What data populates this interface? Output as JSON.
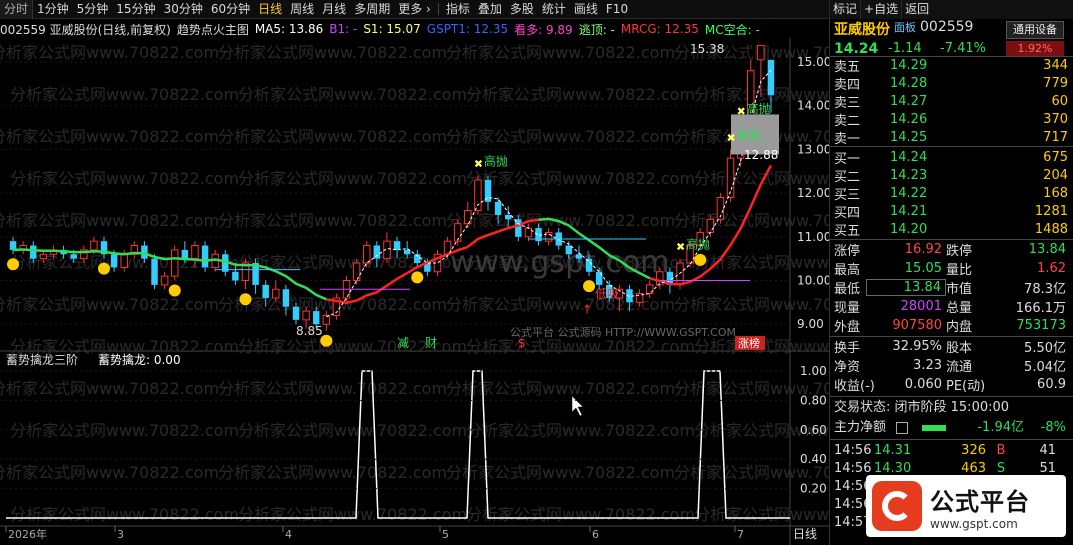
{
  "toolbar": {
    "first": "分时",
    "items": [
      "1分钟",
      "5分钟",
      "15分钟",
      "30分钟",
      "60分钟",
      "日线",
      "周线",
      "月线",
      "多周期",
      "更多"
    ],
    "more_arrow": "更多 ›",
    "buttons": [
      "指标",
      "叠加",
      "多股",
      "统计",
      "画线",
      "F10",
      "标记",
      "+自选",
      "返回"
    ]
  },
  "info": {
    "code_name": "002559 亚威股份(日线,前复权)",
    "indicator": "趋势点火主图",
    "ma5": "MA5: 13.86",
    "b1": "B1: -",
    "s1": "S1: 15.07",
    "gspt": "GSPT1: 12.35",
    "kanduo": "看多: 9.89",
    "taoding": "逃顶: -",
    "mrcg": "MRCG: 12.35",
    "mckonghe": "MC空合: -"
  },
  "chart": {
    "yticks": [
      "15.00",
      "14.00",
      "13.00",
      "12.00",
      "11.00",
      "10.00",
      "9.00"
    ],
    "xticks": [
      "2026年",
      "3",
      "4",
      "5",
      "6",
      "7"
    ],
    "xaxis_right": "日线",
    "ann_high": "15.38",
    "ann_low": "8.85",
    "ann_mid": "12.88",
    "gaopao_labels": [
      "高抛",
      "高抛",
      "高抛",
      "高抛"
    ],
    "dixi": "低吸",
    "event_labels": [
      "减",
      "财",
      "$",
      "涨榜"
    ],
    "watermark": "分析家公式网www.70822.com",
    "site_watermark": "www.gspt.com",
    "platform_text": "公式平台  公式源码 HTTP://WWW.GSPT.COM",
    "sub_title": "蓄势擒龙三阶",
    "sub_value": "蓄势擒龙: 0.00",
    "sub_yticks": [
      "1.00",
      "0.80",
      "0.60",
      "0.40",
      "0.20"
    ]
  },
  "panel": {
    "name": "亚威股份",
    "tag": "面板",
    "code": "002559",
    "gen_device": "通用设备",
    "pct_badge": "1.92%",
    "price": "14.24",
    "change": "-1.14",
    "change_pct": "-7.41%",
    "sells": [
      {
        "label": "卖五",
        "price": "14.29",
        "vol": "344"
      },
      {
        "label": "卖四",
        "price": "14.28",
        "vol": "779"
      },
      {
        "label": "卖三",
        "price": "14.27",
        "vol": "60"
      },
      {
        "label": "卖二",
        "price": "14.26",
        "vol": "370"
      },
      {
        "label": "卖一",
        "price": "14.25",
        "vol": "717"
      }
    ],
    "buys": [
      {
        "label": "买一",
        "price": "14.24",
        "vol": "675"
      },
      {
        "label": "买二",
        "price": "14.23",
        "vol": "204"
      },
      {
        "label": "买三",
        "price": "14.22",
        "vol": "168"
      },
      {
        "label": "买四",
        "price": "14.21",
        "vol": "1281"
      },
      {
        "label": "买五",
        "price": "14.20",
        "vol": "1488"
      }
    ],
    "stats": [
      {
        "k1": "涨停",
        "v1": "16.92",
        "c1": "#ff4444",
        "k2": "跌停",
        "v2": "13.84",
        "c2": "#33dd55"
      },
      {
        "k1": "最高",
        "v1": "15.05",
        "c1": "#33dd55",
        "k2": "量比",
        "v2": "1.62",
        "c2": "#ff4444"
      },
      {
        "k1": "最低",
        "v1": "13.84",
        "c1": "#33dd55",
        "k2": "市值",
        "v2": "78.3亿",
        "c2": "#dddddd"
      },
      {
        "k1": "现量",
        "v1": "28001",
        "c1": "#cc44ff",
        "k2": "总量",
        "v2": "166.1万",
        "c2": "#dddddd"
      },
      {
        "k1": "外盘",
        "v1": "907580",
        "c1": "#ff4444",
        "k2": "内盘",
        "v2": "753173",
        "c2": "#33dd55"
      }
    ],
    "stats2": [
      {
        "k1": "换手",
        "v1": "32.95%",
        "k2": "股本",
        "v2": "5.50亿"
      },
      {
        "k1": "净资",
        "v1": "3.23",
        "k2": "流通",
        "v2": "5.04亿"
      },
      {
        "k1": "收益(-)",
        "v1": "0.060",
        "k2": "PE(动)",
        "v2": "60.9"
      }
    ],
    "trade_state": "交易状态: 闭市阶段 15:00:00",
    "main_net_label": "主力净额",
    "main_net_value": "-1.94亿",
    "main_net_pct": "-8%",
    "ticks": [
      {
        "t": "14:56",
        "p": "14.31",
        "v": "326",
        "bs": "B",
        "bc": "#ff4444",
        "n": "41"
      },
      {
        "t": "14:56",
        "p": "14.30",
        "v": "463",
        "bs": "S",
        "bc": "#33dd55",
        "n": "51"
      },
      {
        "t": "14:56",
        "p": "",
        "v": "",
        "bs": "",
        "bc": "#ddd",
        "n": ""
      },
      {
        "t": "14:56",
        "p": "",
        "v": "",
        "bs": "",
        "bc": "#ddd",
        "n": ""
      },
      {
        "t": "14:57",
        "p": "",
        "v": "",
        "bs": "",
        "bc": "#ddd",
        "n": ""
      }
    ]
  },
  "logo": {
    "title": "公式平台",
    "url": "www.gspt.com"
  },
  "colors": {
    "up": "#ff3333",
    "down": "#33ccff",
    "green": "#33dd55",
    "yellow": "#ffcc00",
    "magenta": "#cc44ff"
  }
}
